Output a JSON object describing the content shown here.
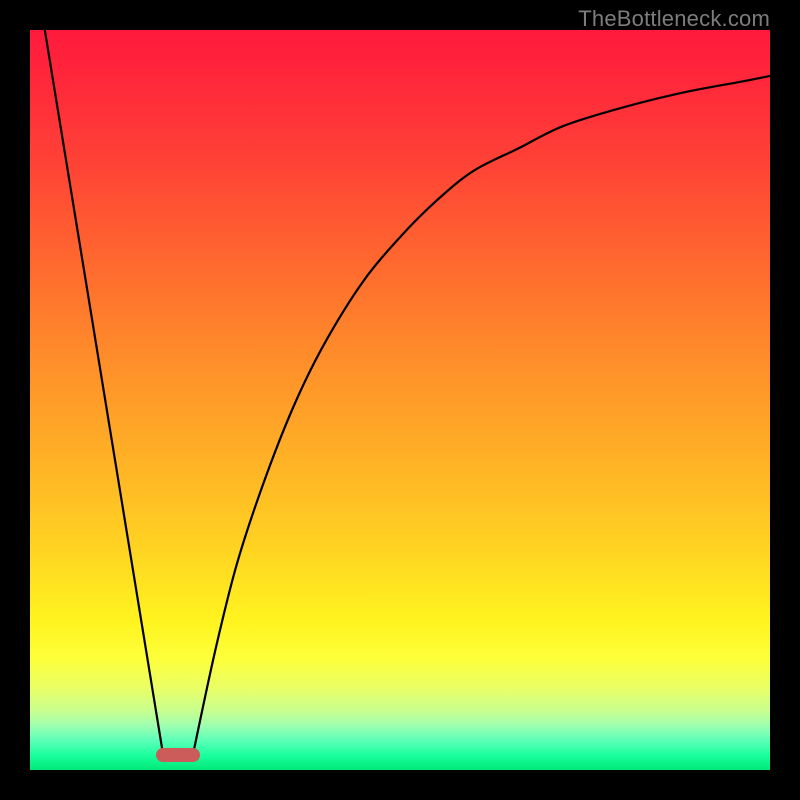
{
  "watermark": "TheBottleneck.com",
  "chart_data": {
    "type": "line",
    "title": "",
    "xlabel": "",
    "ylabel": "",
    "xlim": [
      0,
      100
    ],
    "ylim": [
      0,
      100
    ],
    "grid": false,
    "legend": false,
    "background": "red-yellow-green vertical gradient",
    "series": [
      {
        "name": "left-slope",
        "x": [
          2,
          18
        ],
        "y": [
          100,
          2
        ]
      },
      {
        "name": "right-curve",
        "x": [
          22,
          25,
          28,
          32,
          36,
          40,
          45,
          50,
          55,
          60,
          66,
          72,
          80,
          88,
          96,
          100
        ],
        "y": [
          2,
          16,
          28,
          40,
          50,
          58,
          66,
          72,
          77,
          81,
          84,
          87,
          89.5,
          91.5,
          93,
          93.8
        ]
      }
    ],
    "marker": {
      "x_start": 17,
      "x_end": 23,
      "y": 2,
      "color": "#cc5c59"
    }
  }
}
